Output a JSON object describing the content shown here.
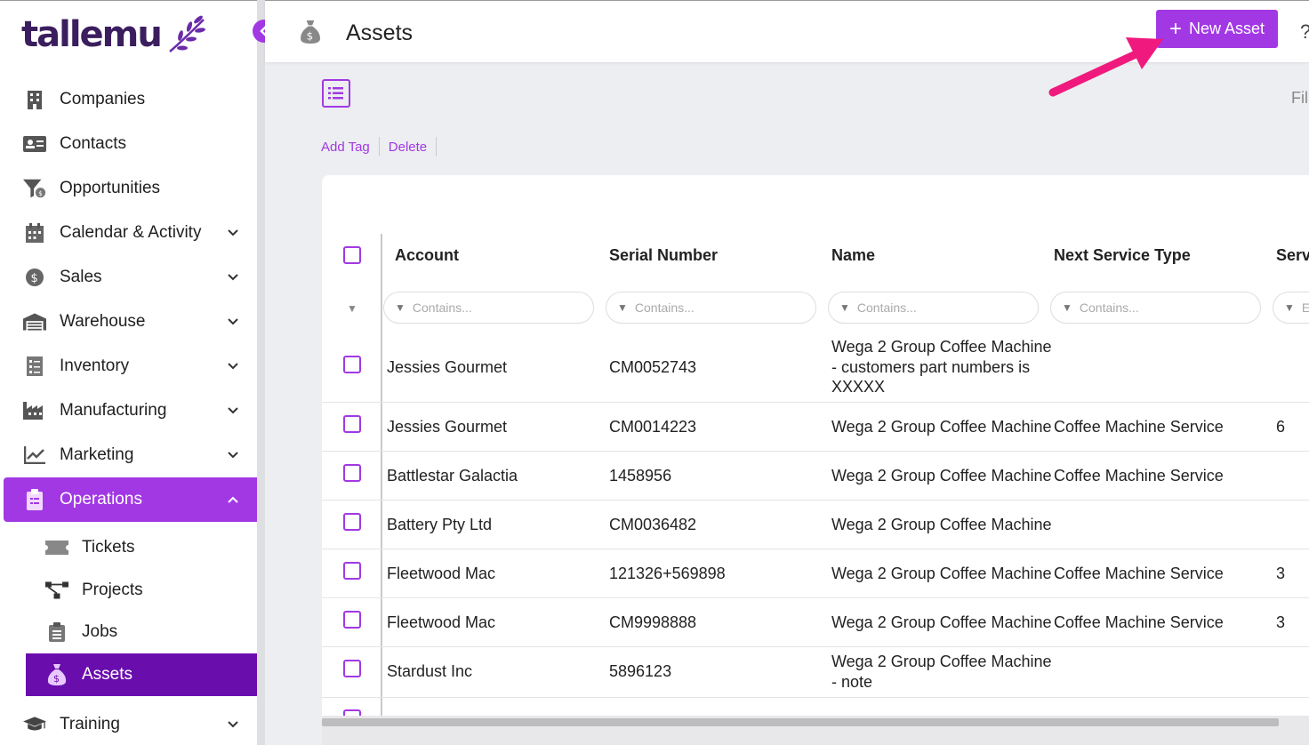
{
  "brand": {
    "name": "tallemu",
    "accent": "#a238e4",
    "dark_accent": "#6a0dad",
    "logo_color": "#3b1e5e"
  },
  "sidebar": {
    "items": [
      {
        "label": "Companies",
        "icon": "building-icon",
        "has_chevron": false
      },
      {
        "label": "Contacts",
        "icon": "id-card-icon",
        "has_chevron": false
      },
      {
        "label": "Opportunities",
        "icon": "funnel-dollar-icon",
        "has_chevron": false
      },
      {
        "label": "Calendar & Activity",
        "icon": "calendar-icon",
        "has_chevron": true
      },
      {
        "label": "Sales",
        "icon": "dollar-circle-icon",
        "has_chevron": true
      },
      {
        "label": "Warehouse",
        "icon": "warehouse-icon",
        "has_chevron": true
      },
      {
        "label": "Inventory",
        "icon": "checklist-icon",
        "has_chevron": true
      },
      {
        "label": "Manufacturing",
        "icon": "factory-icon",
        "has_chevron": true
      },
      {
        "label": "Marketing",
        "icon": "chart-line-icon",
        "has_chevron": true
      },
      {
        "label": "Operations",
        "icon": "clipboard-icon",
        "has_chevron": true,
        "expanded": true
      },
      {
        "label": "Training",
        "icon": "graduation-cap-icon",
        "has_chevron": true
      }
    ],
    "operations_sub": [
      {
        "label": "Tickets",
        "icon": "ticket-icon"
      },
      {
        "label": "Projects",
        "icon": "project-diagram-icon"
      },
      {
        "label": "Jobs",
        "icon": "clipboard-list-icon"
      },
      {
        "label": "Assets",
        "icon": "money-bag-icon",
        "current": true
      }
    ]
  },
  "header": {
    "title": "Assets",
    "new_button": "New Asset"
  },
  "toolbar": {
    "add_tag": "Add Tag",
    "delete": "Delete",
    "filter_partial": "Fil"
  },
  "table": {
    "columns": [
      "Account",
      "Serial Number",
      "Name",
      "Next Service Type",
      "Serv"
    ],
    "filter_placeholder": "Contains...",
    "filter_partial": "E",
    "rows": [
      {
        "account": "Jessies Gourmet",
        "serial": "CM0052743",
        "name_lines": [
          "Wega 2 Group Coffee Machine",
          "- customers part numbers is",
          "XXXXX"
        ],
        "service_type": "",
        "serv": ""
      },
      {
        "account": "Jessies Gourmet",
        "serial": "CM0014223",
        "name_lines": [
          "Wega 2 Group Coffee Machine"
        ],
        "service_type": "Coffee Machine Service",
        "serv": "6"
      },
      {
        "account": "Battlestar Galactia",
        "serial": "1458956",
        "name_lines": [
          "Wega 2 Group Coffee Machine"
        ],
        "service_type": "Coffee Machine Service",
        "serv": ""
      },
      {
        "account": "Battery Pty Ltd",
        "serial": "CM0036482",
        "name_lines": [
          "Wega 2 Group Coffee Machine"
        ],
        "service_type": "",
        "serv": ""
      },
      {
        "account": "Fleetwood Mac",
        "serial": "121326+569898",
        "name_lines": [
          "Wega 2 Group Coffee Machine"
        ],
        "service_type": "Coffee Machine Service",
        "serv": "3"
      },
      {
        "account": "Fleetwood Mac",
        "serial": "CM9998888",
        "name_lines": [
          "Wega 2 Group Coffee Machine"
        ],
        "service_type": "Coffee Machine Service",
        "serv": "3"
      },
      {
        "account": "Stardust Inc",
        "serial": "5896123",
        "name_lines": [
          "Wega 2 Group Coffee Machine",
          "- note"
        ],
        "service_type": "",
        "serv": ""
      }
    ]
  },
  "annotation": {
    "arrow_color": "#f0197d"
  }
}
